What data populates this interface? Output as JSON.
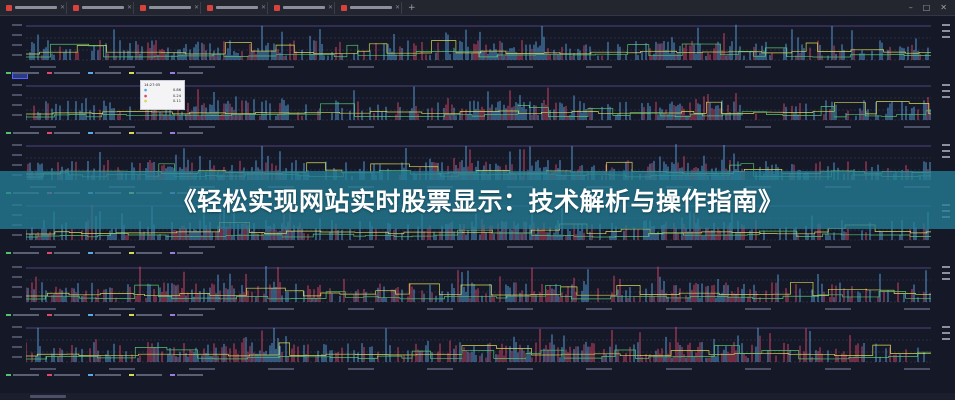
{
  "banner": {
    "title": "《轻松实现网站实时股票显示：技术解析与操作指南》"
  },
  "browser": {
    "tab_count": 6,
    "window_controls": [
      "–",
      "□",
      "✕"
    ],
    "new_tab": "+"
  },
  "tooltip": {
    "header": "14:27:05",
    "rows": [
      {
        "label": "●",
        "value": "0.86"
      },
      {
        "label": "●",
        "value": "0.24"
      },
      {
        "label": "●",
        "value": "0.11"
      },
      {
        "label": "●",
        "value": "0.08"
      }
    ]
  },
  "colors": {
    "background": "#151826",
    "series_blue": "#5aa9e6",
    "series_red": "#e0486b",
    "series_yellow": "#d7d957",
    "series_green": "#56c271",
    "series_purple": "#9b7be0",
    "banner": "#247e96"
  },
  "panels": [
    {
      "id": "p1",
      "legend": [
        "—",
        "—",
        "—",
        "—",
        "—"
      ]
    },
    {
      "id": "p2",
      "legend": [
        "—",
        "—",
        "—",
        "—",
        "—"
      ]
    },
    {
      "id": "p3",
      "legend": [
        "—",
        "—",
        "—",
        "—",
        "—"
      ]
    },
    {
      "id": "p4",
      "legend": [
        "—",
        "—",
        "—",
        "—",
        "—"
      ]
    },
    {
      "id": "p5",
      "legend": [
        "—",
        "—",
        "—",
        "—",
        "—"
      ]
    },
    {
      "id": "p6",
      "legend": [
        "—",
        "—",
        "—",
        "—",
        "—"
      ]
    }
  ]
}
